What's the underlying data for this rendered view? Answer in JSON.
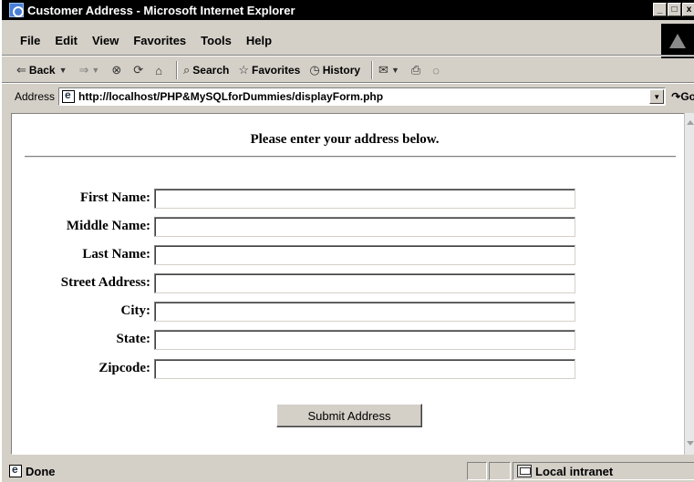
{
  "window": {
    "title": "Customer Address - Microsoft Internet Explorer",
    "controls": {
      "minimize": "_",
      "maximize": "□",
      "close": "x"
    }
  },
  "menu": {
    "items": [
      "File",
      "Edit",
      "View",
      "Favorites",
      "Tools",
      "Help"
    ]
  },
  "toolbar": {
    "back_label": "Back",
    "search_label": "Search",
    "favorites_label": "Favorites",
    "history_label": "History"
  },
  "address": {
    "label": "Address",
    "url": "http://localhost/PHP&MySQLforDummies/displayForm.php",
    "go_label": "Go"
  },
  "page": {
    "heading": "Please enter your address below.",
    "fields": [
      {
        "label": "First Name:",
        "value": ""
      },
      {
        "label": "Middle Name:",
        "value": ""
      },
      {
        "label": "Last Name:",
        "value": ""
      },
      {
        "label": "Street Address:",
        "value": ""
      },
      {
        "label": "City:",
        "value": ""
      },
      {
        "label": "State:",
        "value": ""
      },
      {
        "label": "Zipcode:",
        "value": ""
      }
    ],
    "submit_label": "Submit Address"
  },
  "status": {
    "text": "Done",
    "zone": "Local intranet"
  },
  "icons": {
    "title": "ie-page-icon",
    "logo": "ie-logo-icon",
    "stop": "stop-icon",
    "refresh": "refresh-icon",
    "home": "home-icon",
    "mail": "mail-icon",
    "print": "print-icon",
    "discuss": "discuss-icon"
  }
}
